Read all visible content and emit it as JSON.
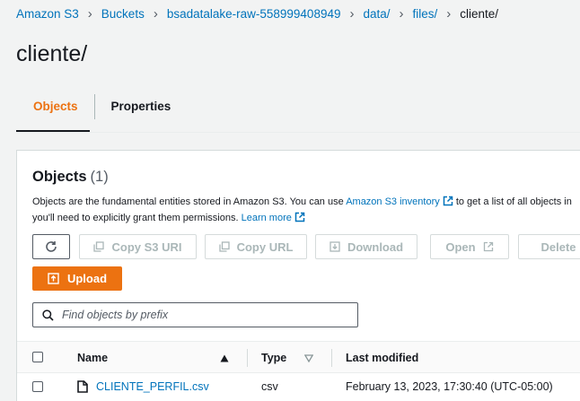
{
  "breadcrumb": {
    "items": [
      "Amazon S3",
      "Buckets",
      "bsadatalake-raw-558999408949",
      "data/",
      "files/"
    ],
    "current": "cliente/"
  },
  "page_title": "cliente/",
  "tabs": [
    {
      "label": "Objects",
      "active": true
    },
    {
      "label": "Properties",
      "active": false
    }
  ],
  "objects_panel": {
    "title": "Objects",
    "count": "(1)",
    "description_part1": "Objects are the fundamental entities stored in Amazon S3. You can use",
    "inventory_link": "Amazon S3 inventory",
    "description_part2": "to get a list of all objects in",
    "description_line2": "you'll need to explicitly grant them permissions.",
    "learn_more": "Learn more"
  },
  "toolbar": {
    "copy_s3_uri": "Copy S3 URI",
    "copy_url": "Copy URL",
    "download": "Download",
    "open": "Open",
    "delete": "Delete",
    "upload": "Upload"
  },
  "search": {
    "placeholder": "Find objects by prefix"
  },
  "table": {
    "columns": [
      "Name",
      "Type",
      "Last modified"
    ],
    "rows": [
      {
        "name": "CLIENTE_PERFIL.csv",
        "type": "csv",
        "last_modified": "February 13, 2023, 17:30:40 (UTC-05:00)"
      }
    ]
  },
  "colors": {
    "accent": "#ec7211",
    "link": "#0073bb",
    "text": "#16191f"
  }
}
